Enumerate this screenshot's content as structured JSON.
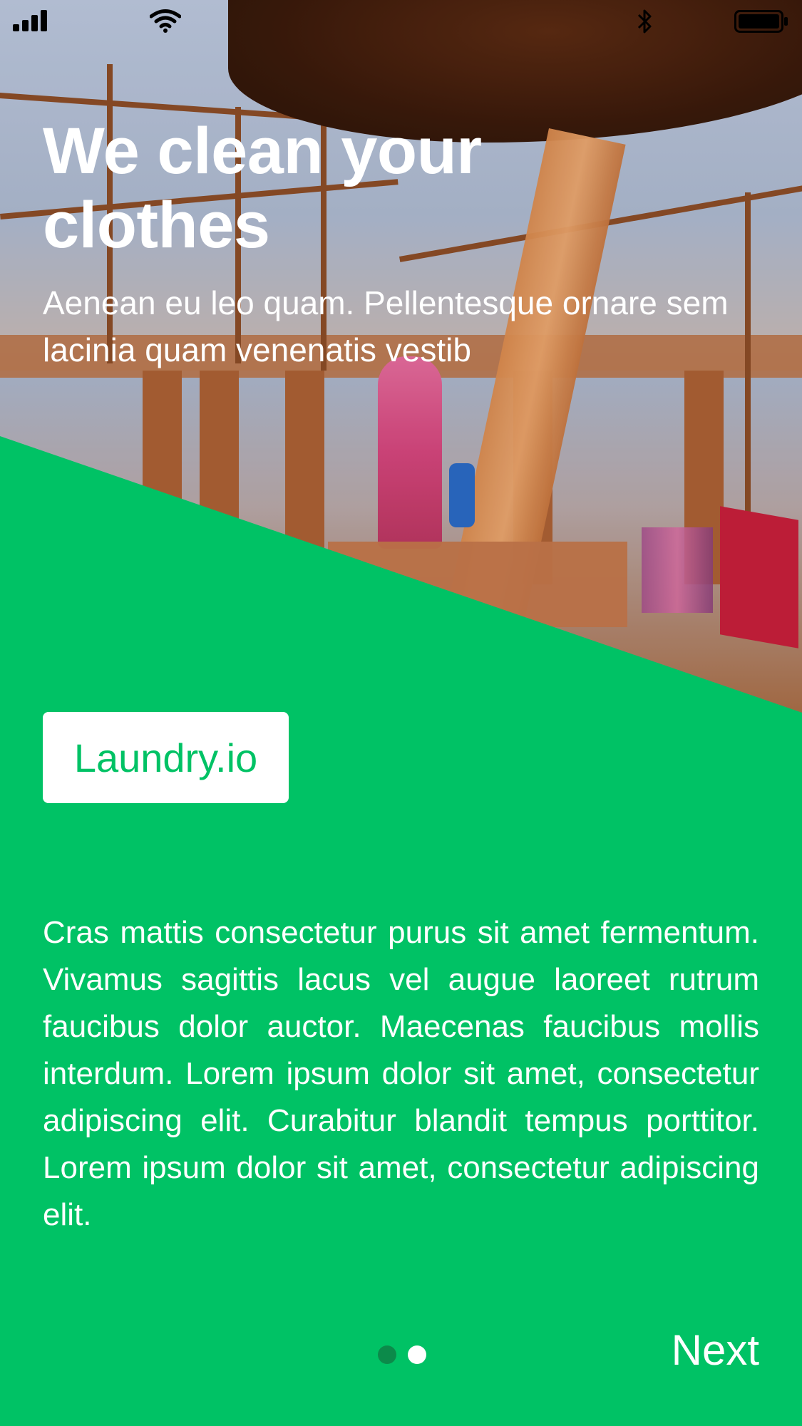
{
  "status_bar": {
    "signal_icon": "cellular-signal-icon",
    "wifi_icon": "wifi-icon",
    "bluetooth_icon": "bluetooth-icon",
    "battery_icon": "battery-icon"
  },
  "hero": {
    "title": "We clean your clothes",
    "subtitle": "Aenean eu leo quam. Pellentesque ornare sem lacinia quam venenatis vestib"
  },
  "brand": {
    "label": "Laundry.io"
  },
  "body": {
    "text": "Cras mattis consectetur purus sit amet fermentum. Vivamus sagittis lacus vel augue laoreet rutrum faucibus dolor auctor. Maecenas faucibus mollis interdum. Lorem ipsum dolor sit amet, consectetur adipiscing elit. Curabitur blandit tempus porttitor. Lorem ipsum dolor sit amet, consectetur adipiscing elit."
  },
  "pagination": {
    "current_page": 1,
    "total_pages": 2
  },
  "footer": {
    "next_label": "Next"
  },
  "colors": {
    "primary_green": "#00C265",
    "active_dot": "#0C8A4A",
    "white": "#FFFFFF"
  }
}
